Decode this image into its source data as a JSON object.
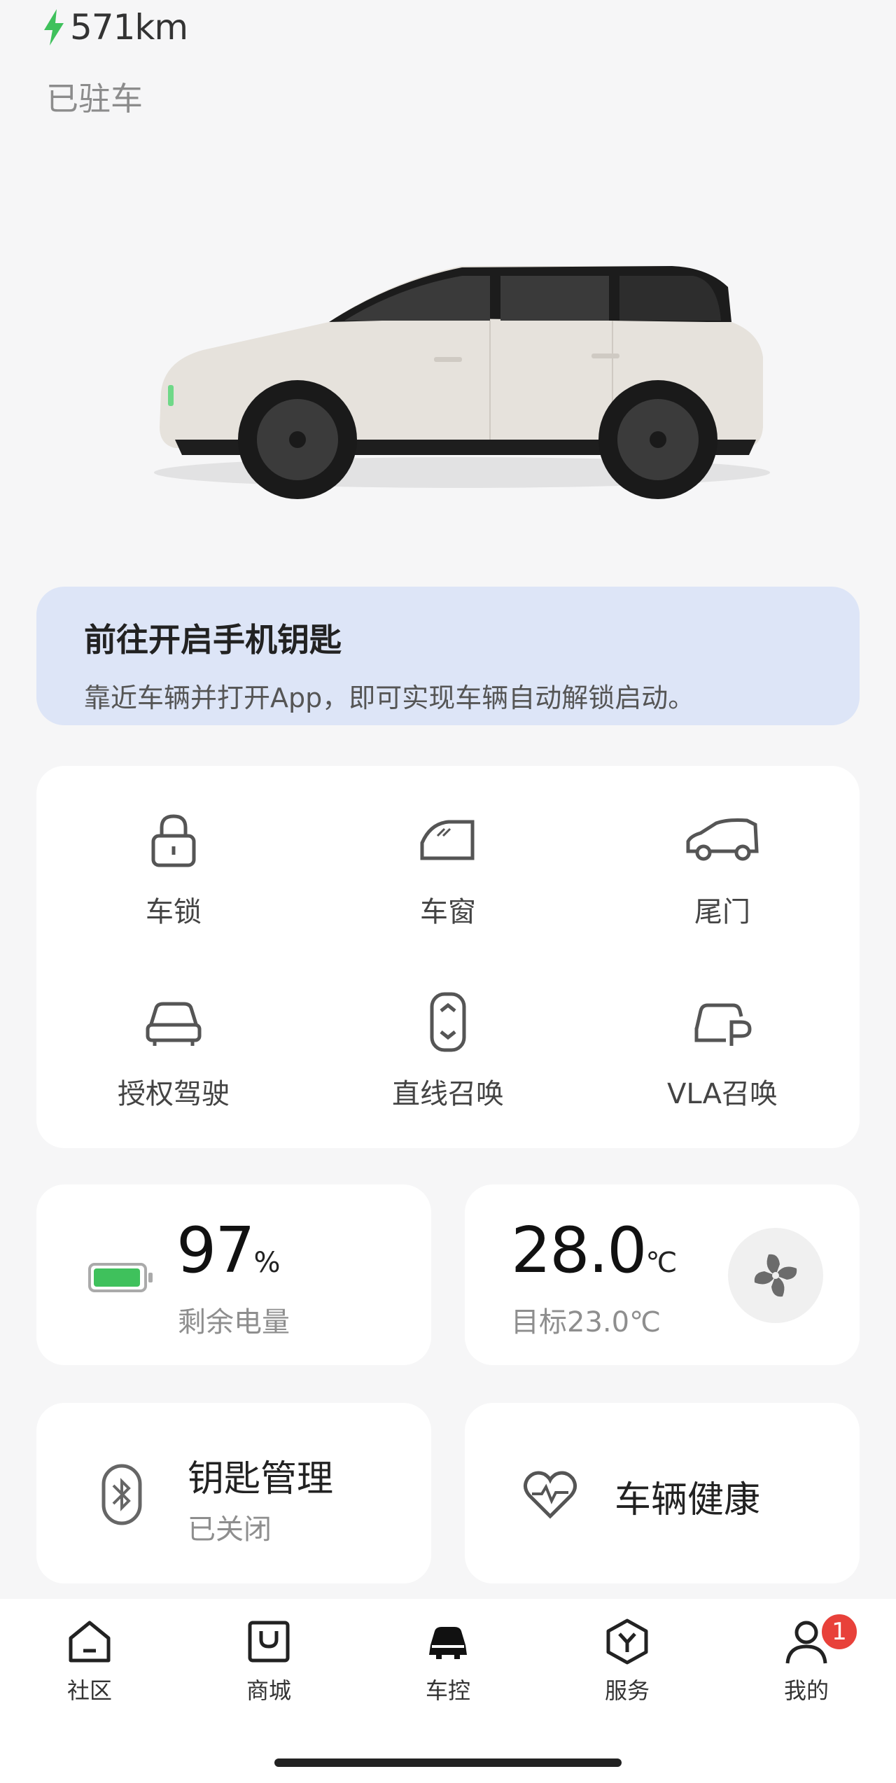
{
  "header": {
    "range": "571km",
    "status": "已驻车"
  },
  "key_banner": {
    "title": "前往开启手机钥匙",
    "subtitle": "靠近车辆并打开App，即可实现车辆自动解锁启动。"
  },
  "controls": [
    {
      "label": "车锁",
      "icon": "lock-icon"
    },
    {
      "label": "车窗",
      "icon": "window-icon"
    },
    {
      "label": "尾门",
      "icon": "tailgate-icon"
    },
    {
      "label": "授权驾驶",
      "icon": "car-front-icon"
    },
    {
      "label": "直线召唤",
      "icon": "summon-icon"
    },
    {
      "label": "VLA召唤",
      "icon": "vla-summon-icon"
    }
  ],
  "battery": {
    "value": "97",
    "unit": "%",
    "label": "剩余电量",
    "level": 0.97,
    "color": "#3fc15c"
  },
  "climate": {
    "value": "28.0",
    "unit": "℃",
    "target": "目标23.0℃"
  },
  "key_mgmt": {
    "title": "钥匙管理",
    "status": "已关闭"
  },
  "health": {
    "title": "车辆健康"
  },
  "tabs": [
    {
      "label": "社区",
      "icon": "home-icon"
    },
    {
      "label": "商城",
      "icon": "shopping-bag-icon"
    },
    {
      "label": "车控",
      "icon": "car-icon"
    },
    {
      "label": "服务",
      "icon": "service-hex-icon"
    },
    {
      "label": "我的",
      "icon": "user-icon",
      "badge": "1"
    }
  ],
  "colors": {
    "accent_green": "#3fc15c",
    "banner_bg": "#dde5f7",
    "badge": "#e8413a"
  }
}
